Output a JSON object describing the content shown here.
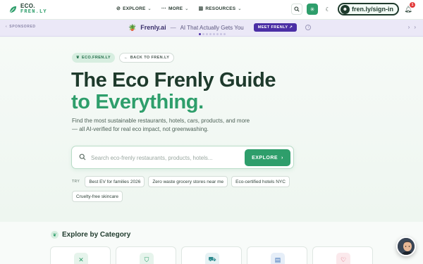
{
  "logo": {
    "line1": "ECO.",
    "line2": "FREN.LY"
  },
  "nav": {
    "links": [
      {
        "label": "EXPLORE",
        "icon": "compass-icon"
      },
      {
        "label": "MORE",
        "icon": "dots-icon"
      },
      {
        "label": "RESOURCES",
        "icon": "bar-chart-icon"
      }
    ],
    "signin_label": "fren.ly/sign-in",
    "notification_count": "1"
  },
  "banner": {
    "sponsored_label": "SPONSORED",
    "brand": "Frenly.ai",
    "separator": "—",
    "tagline": "AI That Actually Gets You",
    "cta_label": "MEET FRENLY",
    "slide_count": 8,
    "active_slide": 0
  },
  "hero": {
    "eco_pill": "ECO.FREN.LY",
    "back_pill": "BACK TO FREN.LY",
    "title_line1": "The Eco Frenly Guide",
    "title_line2": "to Everything.",
    "subtitle": "Find the most sustainable restaurants, hotels, cars, products, and more — all AI-verified for real eco impact, not greenwashing.",
    "search_placeholder": "Search eco-frenly restaurants, products, hotels...",
    "explore_label": "EXPLORE",
    "try_label": "TRY",
    "suggestions": [
      "Best EV for families 2026",
      "Zero waste grocery stores near me",
      "Eco-certified hotels NYC",
      "Cruelty-free skincare"
    ]
  },
  "categories": {
    "title": "Explore by Category",
    "items": [
      {
        "icon": "utensils-icon",
        "color": "#e6f4ec"
      },
      {
        "icon": "basket-icon",
        "color": "#e6f4ec"
      },
      {
        "icon": "car-icon",
        "color": "#e6f2f4"
      },
      {
        "icon": "building-icon",
        "color": "#e6eef8"
      },
      {
        "icon": "heart-icon",
        "color": "#fbe9ec"
      }
    ]
  },
  "colors": {
    "accent": "#2e9e6b",
    "dark": "#1e3a2c",
    "sponsor": "#4b2fa5"
  }
}
